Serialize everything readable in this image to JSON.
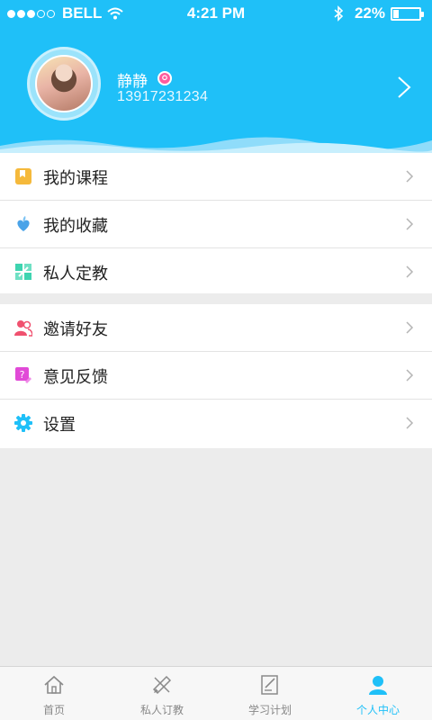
{
  "status_bar": {
    "carrier": "BELL",
    "time": "4:21 PM",
    "battery": "22%",
    "battery_level": 0.22
  },
  "profile": {
    "name": "静静",
    "phone": "13917231234"
  },
  "menu_group_1": [
    {
      "label": "我的课程",
      "icon": "book-icon",
      "color": "#f5b93b"
    },
    {
      "label": "我的收藏",
      "icon": "heart-leaf-icon",
      "color": "#4aa3e8"
    },
    {
      "label": "私人定教",
      "icon": "puzzle-icon",
      "color": "#3ed4b0"
    }
  ],
  "menu_group_2": [
    {
      "label": "邀请好友",
      "icon": "friends-icon",
      "color": "#f0516f"
    },
    {
      "label": "意见反馈",
      "icon": "feedback-icon",
      "color": "#e14ad7"
    },
    {
      "label": "设置",
      "icon": "gear-icon",
      "color": "#1fc0f8"
    }
  ],
  "tabs": [
    {
      "label": "首页",
      "icon": "home-icon",
      "active": false
    },
    {
      "label": "私人订教",
      "icon": "pencil-ruler-icon",
      "active": false
    },
    {
      "label": "学习计划",
      "icon": "notepad-icon",
      "active": false
    },
    {
      "label": "个人中心",
      "icon": "person-icon",
      "active": true
    }
  ],
  "colors": {
    "accent": "#1fc0f8",
    "background": "#ececec",
    "tab_inactive": "#888888"
  }
}
